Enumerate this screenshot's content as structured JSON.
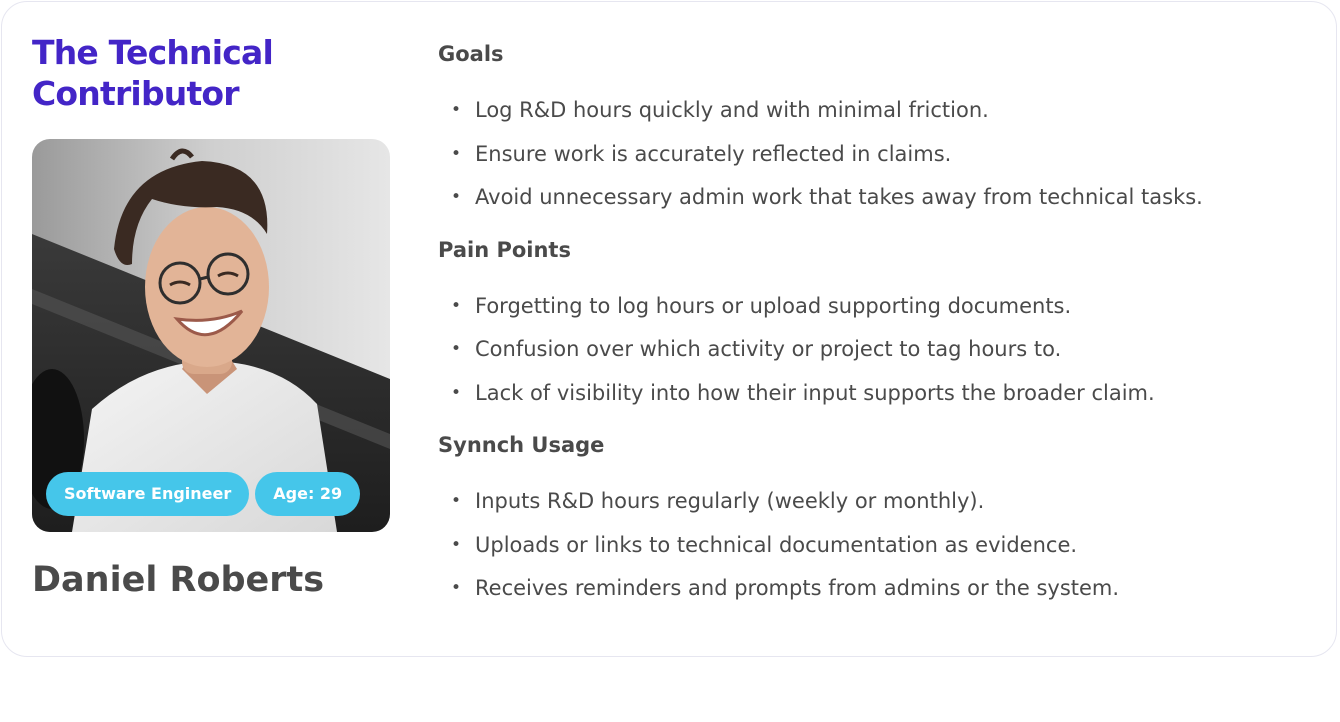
{
  "persona": {
    "title": "The Technical Contributor",
    "name": "Daniel Roberts",
    "badges": {
      "role": "Software Engineer",
      "age": "Age: 29"
    },
    "photo_alt": "avatar-photo"
  },
  "sections": [
    {
      "heading": "Goals",
      "items": [
        "Log R&D hours quickly and with minimal friction.",
        "Ensure work is accurately reflected in claims.",
        "Avoid unnecessary admin work that takes away from technical tasks."
      ]
    },
    {
      "heading": "Pain Points",
      "items": [
        "Forgetting to log hours or upload supporting documents.",
        "Confusion over which activity or project to tag hours to.",
        "Lack of visibility into how their input supports the broader claim."
      ]
    },
    {
      "heading": "Synnch Usage",
      "items": [
        "Inputs R&D hours regularly (weekly or monthly).",
        "Uploads or links to technical documentation as evidence.",
        "Receives reminders and prompts from admins or the system."
      ]
    }
  ],
  "colors": {
    "title": "#4325c7",
    "badge": "#45c6ea",
    "text": "#4a4a4a",
    "border": "#e6e6f0"
  }
}
